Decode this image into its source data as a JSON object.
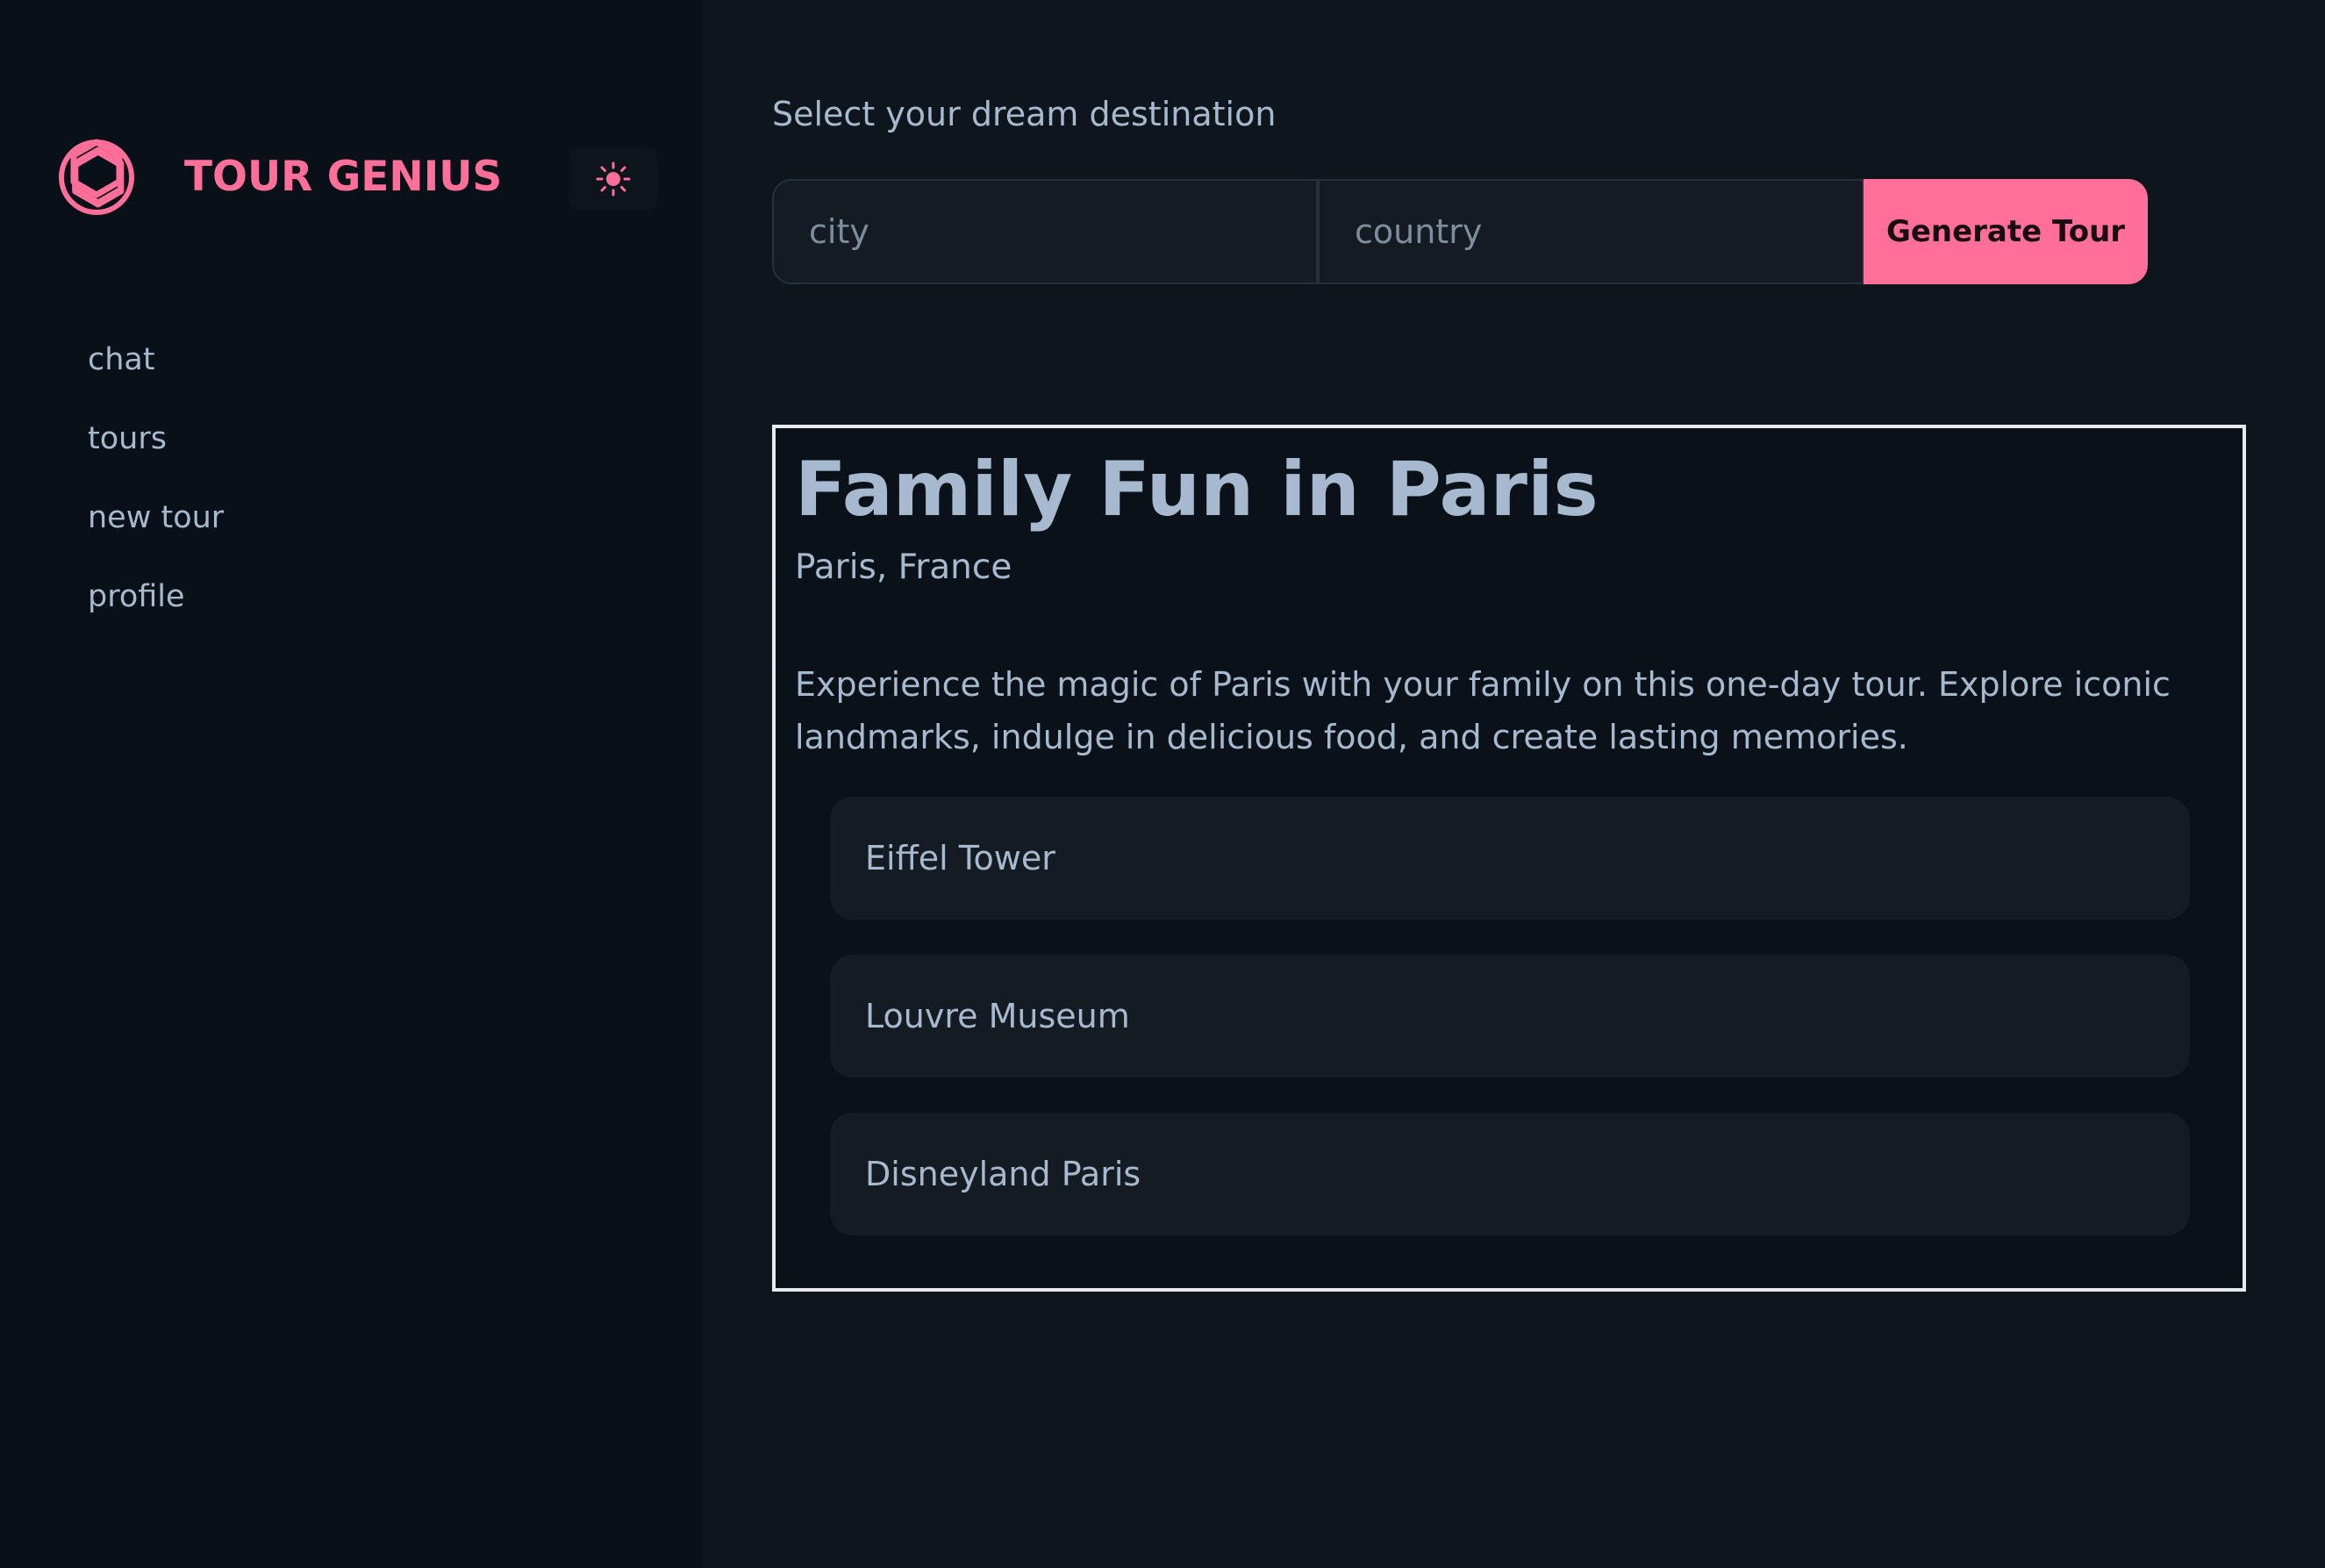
{
  "brand": {
    "title": "TOUR GENIUS",
    "accent_color": "#ff6f9a",
    "logo_icon": "openai-knot-icon"
  },
  "theme_toggle": {
    "icon": "sun-icon"
  },
  "nav": {
    "items": [
      {
        "label": "chat"
      },
      {
        "label": "tours"
      },
      {
        "label": "new tour"
      },
      {
        "label": "profile"
      }
    ]
  },
  "search": {
    "label": "Select your dream destination",
    "city_placeholder": "city",
    "country_placeholder": "country",
    "button_label": "Generate Tour"
  },
  "tour": {
    "title": "Family Fun in Paris",
    "location": "Paris, France",
    "description": "Experience the magic of Paris with your family on this one-day tour. Explore iconic landmarks, indulge in delicious food, and create lasting memories.",
    "stops": [
      {
        "name": "Eiffel Tower"
      },
      {
        "name": "Louvre Museum"
      },
      {
        "name": "Disneyland Paris"
      }
    ]
  }
}
